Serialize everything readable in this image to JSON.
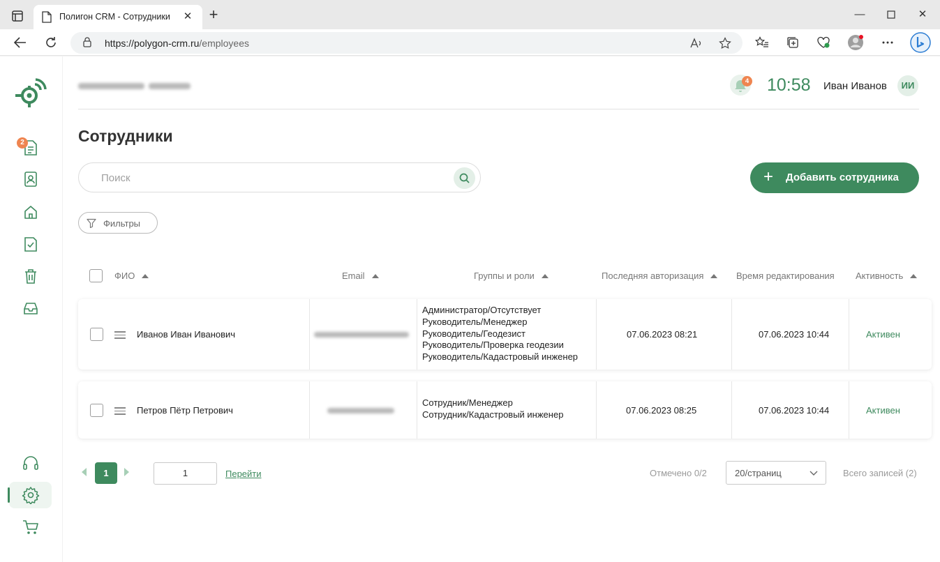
{
  "browser": {
    "tab_title": "Полигон CRM - Сотрудники",
    "url_host": "https://polygon-crm.ru",
    "url_path": "/employees",
    "profile_color": "#e81123"
  },
  "sidebar": {
    "documents_badge": "2",
    "active_item": "settings",
    "items": [
      "documents-icon",
      "contacts-icon",
      "home-icon",
      "checklist-icon",
      "trash-icon",
      "inbox-icon",
      "headset-icon",
      "gear-icon",
      "cart-icon"
    ]
  },
  "header": {
    "notifications_count": "4",
    "time": "10:58",
    "user_name": "Иван Иванов",
    "user_initials": "ИИ"
  },
  "page": {
    "title": "Сотрудники",
    "search_placeholder": "Поиск",
    "add_button": "Добавить сотрудника",
    "filters_button": "Фильтры"
  },
  "table": {
    "columns": {
      "name": "ФИО",
      "email": "Email",
      "roles": "Группы и роли",
      "last_login": "Последняя авторизация",
      "edit_time": "Время редактирования",
      "status": "Активность"
    },
    "rows": [
      {
        "name": "Иванов Иван Иванович",
        "roles": [
          "Администратор/Отсутствует",
          "Руководитель/Менеджер",
          "Руководитель/Геодезист",
          "Руководитель/Проверка геодезии",
          "Руководитель/Кадастровый инженер"
        ],
        "last_login": "07.06.2023 08:21",
        "edit_time": "07.06.2023 10:44",
        "status": "Активен"
      },
      {
        "name": "Петров Пётр Петрович",
        "roles": [
          "Сотрудник/Менеджер",
          "Сотрудник/Кадастровый инженер"
        ],
        "last_login": "07.06.2023 08:25",
        "edit_time": "07.06.2023 10:44",
        "status": "Активен"
      }
    ]
  },
  "pagination": {
    "current_page": "1",
    "page_input": "1",
    "goto_label": "Перейти",
    "marked": "Отмечено 0/2",
    "per_page": "20/страниц",
    "total": "Всего записей (2)"
  },
  "colors": {
    "accent": "#3e8a5e",
    "badge": "#ef8550"
  }
}
